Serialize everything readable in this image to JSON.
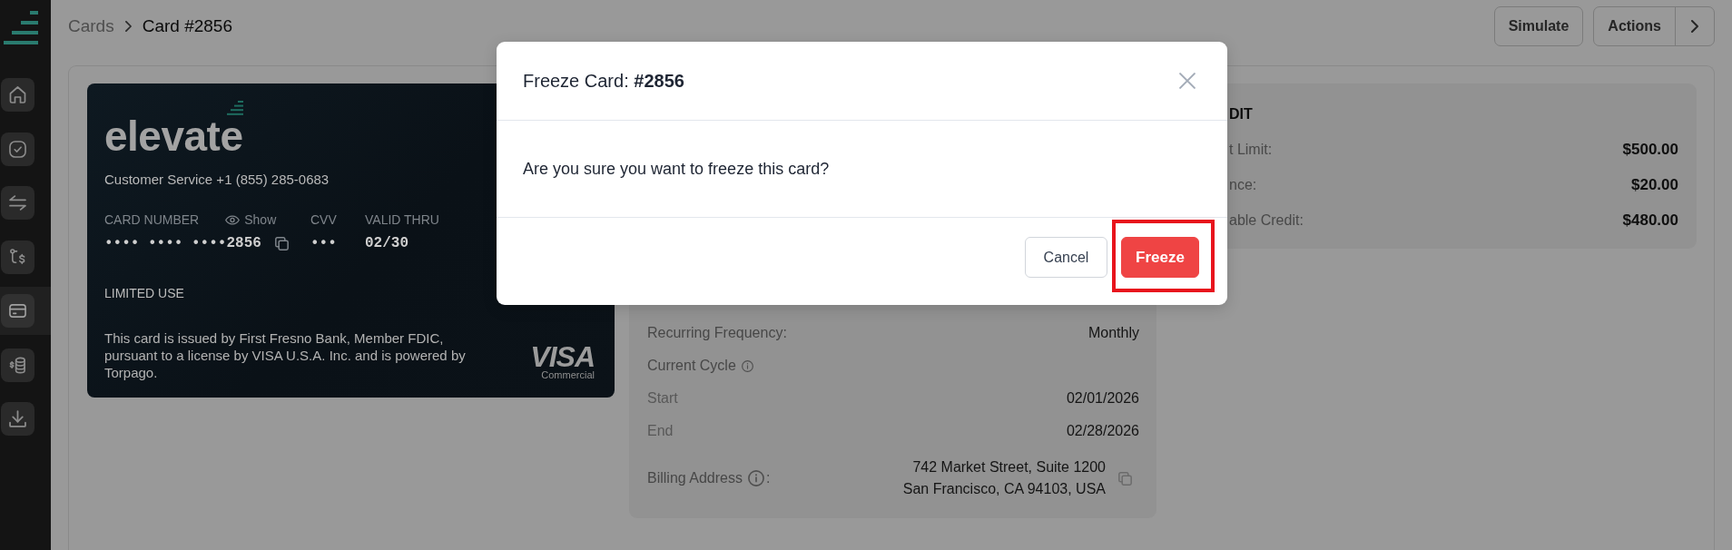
{
  "sidebar": {
    "items": [
      {
        "kind": "home",
        "selected": false
      },
      {
        "kind": "check",
        "selected": false
      },
      {
        "kind": "transfer",
        "selected": false
      },
      {
        "kind": "route",
        "selected": false
      },
      {
        "kind": "card",
        "selected": true
      },
      {
        "kind": "coins",
        "selected": false
      },
      {
        "kind": "download",
        "selected": false
      }
    ]
  },
  "breadcrumb": [
    {
      "label": "Cards",
      "current": false
    },
    {
      "label": "Card #2856",
      "current": true
    }
  ],
  "header_buttons": [
    {
      "label": "Simulate",
      "kind": "plain"
    },
    {
      "label": "Actions",
      "kind": "split"
    }
  ],
  "card": {
    "brand": "elevate",
    "service": "Customer Service +1 (855) 285-0683",
    "fields": [
      {
        "label": "CARD NUMBER",
        "toggle": "Show",
        "value": "•••• •••• ••••2856",
        "copyable": true
      },
      {
        "label": "CVV",
        "value": "•••",
        "copyable": false
      },
      {
        "label": "VALID THRU",
        "value": "02/30",
        "copyable": false
      }
    ],
    "usage": "LIMITED USE",
    "disclaimer": "This card is issued by First Fresno Bank, Member FDIC, pursuant to a license by VISA U.S.A. Inc. and is powered by Torpago.",
    "network": "VISA",
    "network_tier": "Commercial"
  },
  "details": {
    "rows": [
      {
        "kind": "pair",
        "label": "Recurring Frequency:",
        "value": "Monthly",
        "info": false,
        "copyable": false
      },
      {
        "kind": "heading",
        "label": "Current Cycle",
        "info": true,
        "copyable": false
      },
      {
        "kind": "subpair",
        "label": "Start",
        "value": "02/01/2026",
        "info": false,
        "copyable": false
      },
      {
        "kind": "subpair",
        "label": "End",
        "value": "02/28/2026",
        "info": false,
        "copyable": false
      },
      {
        "kind": "address",
        "label": "Billing Address",
        "label_suffix": ":",
        "lines": [
          "742 Market Street, Suite 1200",
          "San Francisco, CA 94103, USA"
        ],
        "info": true,
        "copyable": true
      }
    ]
  },
  "credit": {
    "title": "DIT",
    "rows": [
      {
        "label": "t Limit:",
        "value": "$500.00"
      },
      {
        "label": "nce:",
        "value": "$20.00"
      },
      {
        "label": "able Credit:",
        "value": "$480.00"
      }
    ]
  },
  "modal": {
    "title": "Freeze Card: **#2856**",
    "message": "Are you sure you want to freeze this card?",
    "buttons": [
      {
        "label": "Cancel",
        "kind": "secondary",
        "highlighted": false
      },
      {
        "label": "Freeze",
        "kind": "danger",
        "highlighted": true
      }
    ]
  }
}
